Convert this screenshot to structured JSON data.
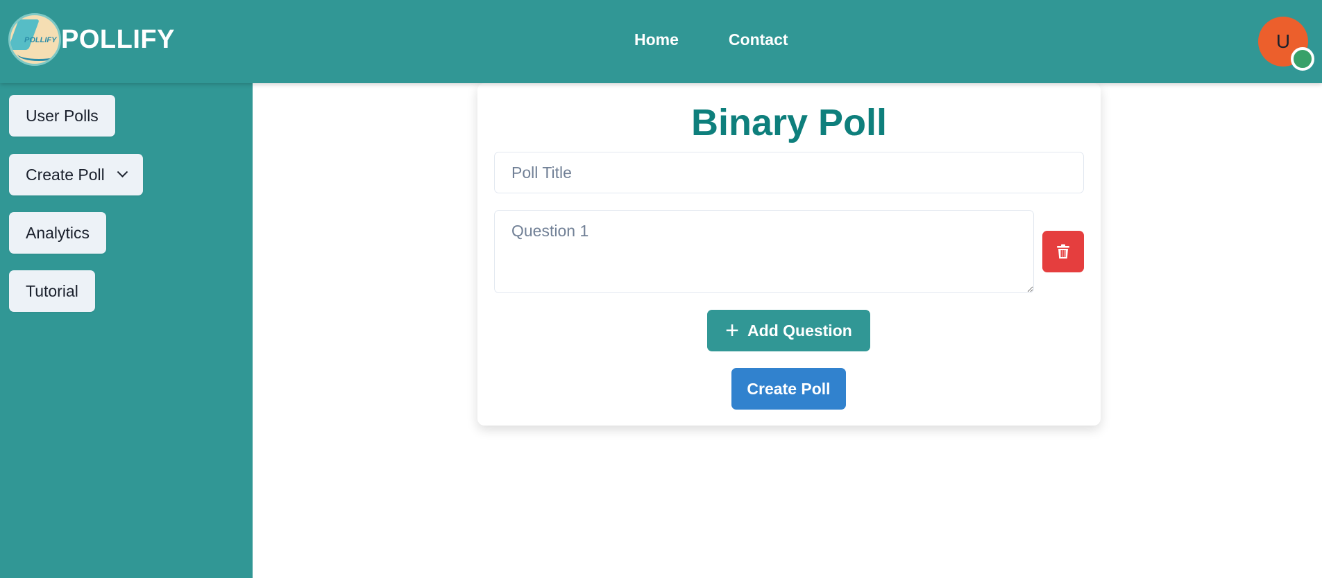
{
  "header": {
    "brand": "POLLIFY",
    "logo_text": "POLLIFY",
    "nav": [
      {
        "label": "Home"
      },
      {
        "label": "Contact"
      }
    ],
    "avatar_initial": "U",
    "avatar_status": "online"
  },
  "sidebar": {
    "items": [
      {
        "label": "User Polls"
      },
      {
        "label": "Create Poll",
        "has_dropdown": true
      },
      {
        "label": "Analytics"
      },
      {
        "label": "Tutorial"
      }
    ]
  },
  "form": {
    "title": "Binary Poll",
    "poll_title_placeholder": "Poll Title",
    "poll_title_value": "",
    "questions": [
      {
        "placeholder": "Question 1",
        "value": ""
      }
    ],
    "add_question_label": "Add Question",
    "create_poll_label": "Create Poll"
  },
  "colors": {
    "primary_teal": "#319795",
    "title_teal": "#0e7f7c",
    "danger": "#e53e3e",
    "primary_blue": "#3182ce",
    "avatar": "#ec5f2c",
    "status_online": "#38a169"
  }
}
